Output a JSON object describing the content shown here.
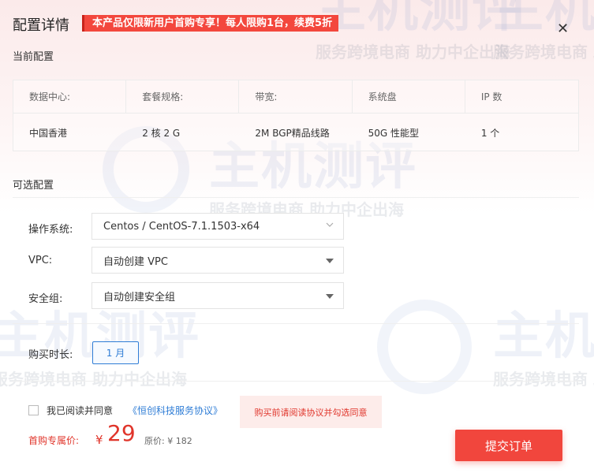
{
  "header": {
    "title": "配置详情",
    "promo": "本产品仅限新用户首购专享！每人限购1台，续费5折",
    "close": "✕"
  },
  "watermark": {
    "logo_text": "主机测评",
    "slogan": "服务跨境电商 助力中企出海"
  },
  "current": {
    "section_label": "当前配置",
    "columns": [
      "数据中心:",
      "套餐规格:",
      "带宽:",
      "系统盘",
      "IP 数"
    ],
    "values": [
      "中国香港",
      "2 核 2 G",
      "2M BGP精品线路",
      "50G 性能型",
      "1 个"
    ]
  },
  "optional": {
    "section_label": "可选配置",
    "os_label": "操作系统:",
    "os_value": "Centos / CentOS-7.1.1503-x64",
    "vpc_label": "VPC:",
    "vpc_value": "自动创建 VPC",
    "sg_label": "安全组:",
    "sg_value": "自动创建安全组"
  },
  "duration": {
    "label": "购买时长:",
    "value": "1 月"
  },
  "agreement": {
    "prefix": "我已阅读并同意",
    "link": "《恒创科技服务协议》",
    "warning": "购买前请阅读协议并勾选同意"
  },
  "price": {
    "label": "首购专属价:",
    "currency": "¥",
    "value": "29",
    "original": "原价: ¥ 182"
  },
  "submit_label": "提交订单",
  "colors": {
    "accent_red": "#f1463d",
    "link_blue": "#2f7dd6"
  }
}
